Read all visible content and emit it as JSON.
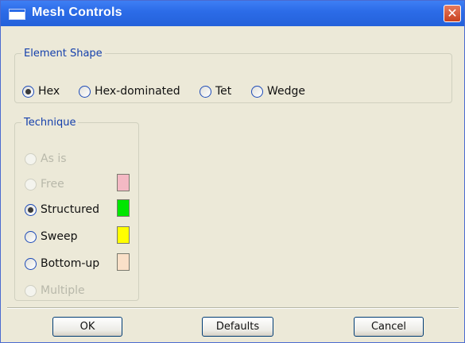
{
  "window": {
    "title": "Mesh Controls",
    "close_glyph": "✕"
  },
  "element_shape": {
    "legend": "Element Shape",
    "options": [
      {
        "label": "Hex",
        "checked": true
      },
      {
        "label": "Hex-dominated",
        "checked": false
      },
      {
        "label": "Tet",
        "checked": false
      },
      {
        "label": "Wedge",
        "checked": false
      }
    ]
  },
  "technique": {
    "legend": "Technique",
    "options": [
      {
        "label": "As is",
        "checked": false,
        "enabled": false,
        "swatch": null
      },
      {
        "label": "Free",
        "checked": false,
        "enabled": false,
        "swatch": "#f4b9c4"
      },
      {
        "label": "Structured",
        "checked": true,
        "enabled": true,
        "swatch": "#00e600"
      },
      {
        "label": "Sweep",
        "checked": false,
        "enabled": true,
        "swatch": "#ffff00"
      },
      {
        "label": "Bottom-up",
        "checked": false,
        "enabled": true,
        "swatch": "#fae0c8"
      },
      {
        "label": "Multiple",
        "checked": false,
        "enabled": false,
        "swatch": null
      }
    ]
  },
  "buttons": {
    "ok": "OK",
    "defaults": "Defaults",
    "cancel": "Cancel"
  }
}
